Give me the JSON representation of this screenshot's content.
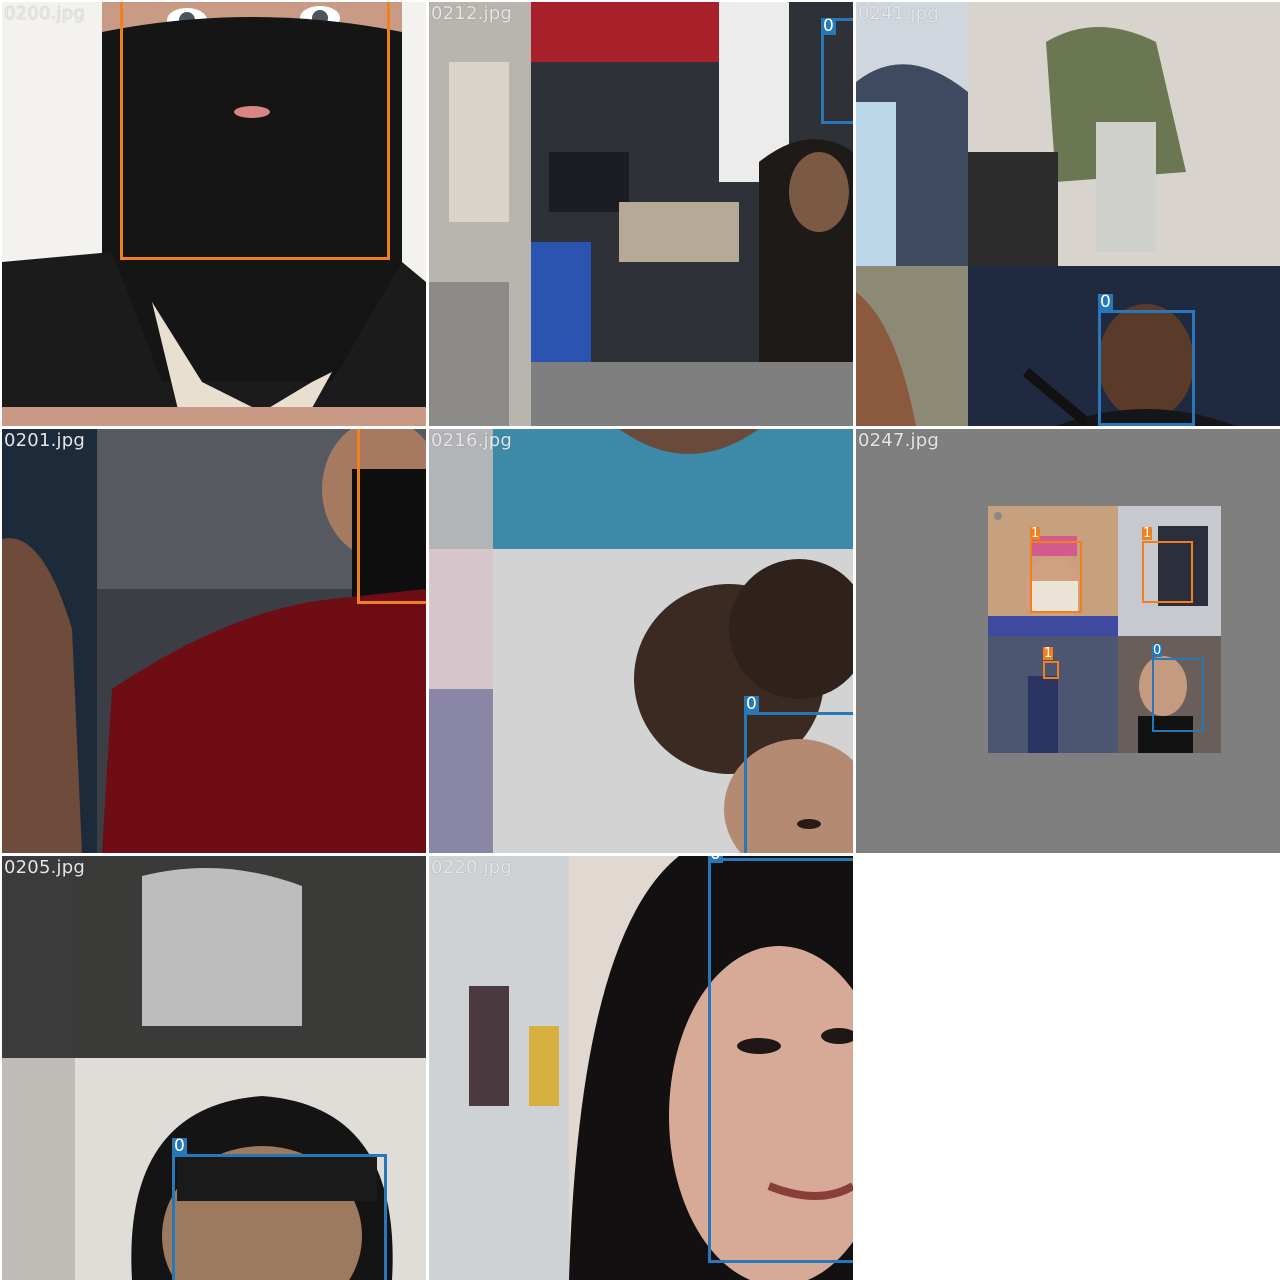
{
  "mosaic": {
    "tiles": [
      {
        "filename": "0200.jpg",
        "labels": [
          "1"
        ]
      },
      {
        "filename": "0212.jpg",
        "labels": [
          "0"
        ]
      },
      {
        "filename": "0241.jpg",
        "labels": [
          "0"
        ]
      },
      {
        "filename": "0201.jpg",
        "labels": [
          "1"
        ]
      },
      {
        "filename": "0216.jpg",
        "labels": [
          "0"
        ]
      },
      {
        "filename": "0247.jpg",
        "labels": [
          "1",
          "1",
          "1",
          "0"
        ]
      },
      {
        "filename": "0205.jpg",
        "labels": [
          "0"
        ]
      },
      {
        "filename": "0220.jpg",
        "labels": [
          "0"
        ]
      }
    ]
  },
  "colors": {
    "class_0": "#2878b8",
    "class_1": "#f07f1e",
    "background": "#7f7f7f"
  }
}
